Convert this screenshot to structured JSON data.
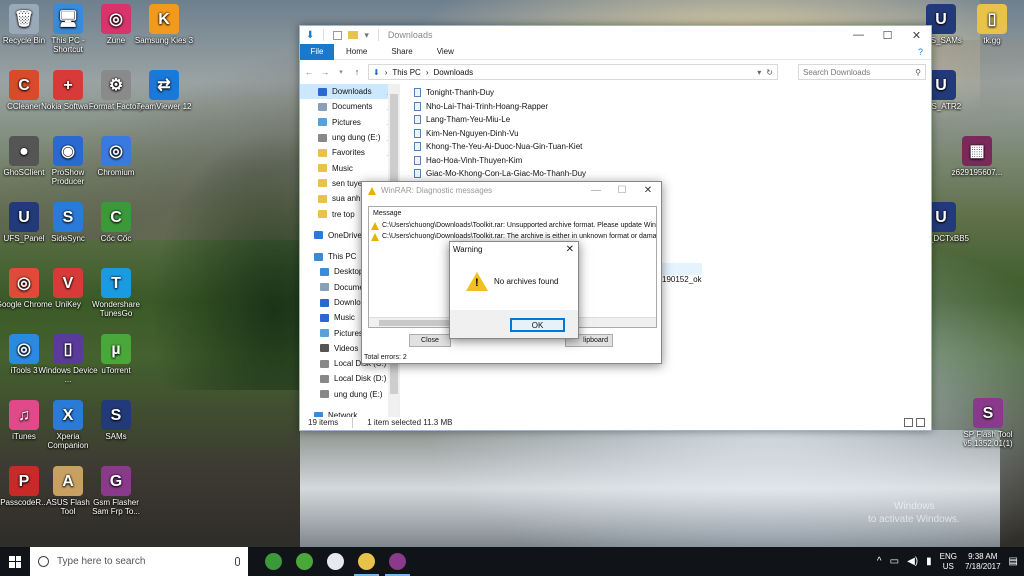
{
  "desktop_icons": [
    {
      "label": "Recycle Bin",
      "icon": "recycle-bin-icon",
      "color": "#9aa9b8",
      "glyph": "🗑"
    },
    {
      "label": "This PC - Shortcut",
      "icon": "computer-icon",
      "color": "#3a8ad8",
      "glyph": "🖥"
    },
    {
      "label": "Zune",
      "icon": "zune-icon",
      "color": "#d8336a",
      "glyph": "◎"
    },
    {
      "label": "Samsung Kies 3",
      "icon": "kies-icon",
      "color": "#f29a1d",
      "glyph": "K"
    },
    {
      "label": "CCleaner",
      "icon": "ccleaner-icon",
      "color": "#d84a2a",
      "glyph": "C"
    },
    {
      "label": "Nokia Softwa...",
      "icon": "nokia-icon",
      "color": "#d83a3a",
      "glyph": "+"
    },
    {
      "label": "Format Factory",
      "icon": "format-factory-icon",
      "color": "#8a8a8a",
      "glyph": "⚙"
    },
    {
      "label": "TeamViewer 12",
      "icon": "teamviewer-icon",
      "color": "#1a78d8",
      "glyph": "⇄"
    },
    {
      "label": "GhoSClient",
      "icon": "ghost-icon",
      "color": "#555555",
      "glyph": "●"
    },
    {
      "label": "ProShow Producer",
      "icon": "proshow-icon",
      "color": "#2a6ad0",
      "glyph": "◉"
    },
    {
      "label": "Chromium",
      "icon": "chromium-icon",
      "color": "#3a7ae0",
      "glyph": "◎"
    },
    {
      "label": "UFS_Panel",
      "icon": "ufs-panel-icon",
      "color": "#233a7a",
      "glyph": "U"
    },
    {
      "label": "SideSync",
      "icon": "sidesync-icon",
      "color": "#2a7ad8",
      "glyph": "S"
    },
    {
      "label": "Cốc Cốc",
      "icon": "coccoc-icon",
      "color": "#3a9a3a",
      "glyph": "C"
    },
    {
      "label": "Google Chrome",
      "icon": "chrome-icon",
      "color": "#e04a3a",
      "glyph": "◎"
    },
    {
      "label": "UniKey",
      "icon": "unikey-icon",
      "color": "#d83a3a",
      "glyph": "V"
    },
    {
      "label": "Wondershare TunesGo",
      "icon": "tunesgo-icon",
      "color": "#1a9ae0",
      "glyph": "T"
    },
    {
      "label": "iTools 3",
      "icon": "itools-icon",
      "color": "#2a8ae0",
      "glyph": "◎"
    },
    {
      "label": "Windows Device ...",
      "icon": "windows-device-icon",
      "color": "#5a3a9a",
      "glyph": "▯"
    },
    {
      "label": "uTorrent",
      "icon": "utorrent-icon",
      "color": "#4aa83a",
      "glyph": "µ"
    },
    {
      "label": "iTunes",
      "icon": "itunes-icon",
      "color": "#e04a8a",
      "glyph": "♫"
    },
    {
      "label": "Xperia Companion",
      "icon": "xperia-icon",
      "color": "#2a7ad8",
      "glyph": "X"
    },
    {
      "label": "SAMs",
      "icon": "sams-icon",
      "color": "#233a7a",
      "glyph": "S"
    },
    {
      "label": "PasscodeR...",
      "icon": "passcode-icon",
      "color": "#c82a2a",
      "glyph": "P"
    },
    {
      "label": "ASUS Flash Tool",
      "icon": "asus-flash-icon",
      "color": "#c8a060",
      "glyph": "A"
    },
    {
      "label": "Gsm Flasher Sam Frp To...",
      "icon": "gsm-flasher-icon",
      "color": "#8a3a8a",
      "glyph": "G"
    },
    {
      "label": "UFS_SAMs",
      "icon": "ufs-sams-icon",
      "color": "#233a7a",
      "glyph": "U"
    },
    {
      "label": "tk.gg",
      "icon": "file-icon",
      "color": "#e8c24a",
      "glyph": "▯"
    },
    {
      "label": "UFS_ATR2",
      "icon": "ufs-atr2-icon",
      "color": "#233a7a",
      "glyph": "U"
    },
    {
      "label": "z629195607...",
      "icon": "image-file-icon",
      "color": "#7a2a5a",
      "glyph": "▦"
    },
    {
      "label": "UFS_DCTxBB5",
      "icon": "ufs-dct-icon",
      "color": "#233a7a",
      "glyph": "U"
    },
    {
      "label": "SP Flash Tool v5.1352.01(1)",
      "icon": "sp-flash-icon",
      "color": "#8a3a8a",
      "glyph": "S"
    }
  ],
  "explorer": {
    "title": "Downloads",
    "ribbon_tabs": [
      "File",
      "Home",
      "Share",
      "View"
    ],
    "path": [
      "This PC",
      "Downloads"
    ],
    "search_placeholder": "Search Downloads",
    "nav_items": [
      {
        "label": "Downloads",
        "selected": true,
        "pin": true,
        "color": "#2a6ad0"
      },
      {
        "label": "Documents",
        "pin": true,
        "color": "#8aa0b8"
      },
      {
        "label": "Pictures",
        "pin": true,
        "color": "#5aa0d8"
      },
      {
        "label": "ung dung (E:)",
        "pin": true,
        "color": "#888888"
      },
      {
        "label": "Favorites",
        "pin": true,
        "color": "#e8c24a"
      },
      {
        "label": "Music",
        "color": "#e8c24a"
      },
      {
        "label": "sen tuyen",
        "color": "#e8c24a"
      },
      {
        "label": "sua anh",
        "color": "#e8c24a"
      },
      {
        "label": "tre top",
        "color": "#e8c24a"
      },
      {
        "label": "OneDrive",
        "color": "#2a7ad8",
        "group": true
      },
      {
        "label": "This PC",
        "color": "#3a8ad8",
        "group": true
      },
      {
        "label": "Desktop",
        "color": "#3a8ad8",
        "sub": true
      },
      {
        "label": "Documents",
        "color": "#8aa0b8",
        "sub": true
      },
      {
        "label": "Downloads",
        "color": "#2a6ad0",
        "sub": true
      },
      {
        "label": "Music",
        "color": "#2a6ad0",
        "sub": true
      },
      {
        "label": "Pictures",
        "color": "#5aa0d8",
        "sub": true
      },
      {
        "label": "Videos",
        "color": "#555555",
        "sub": true
      },
      {
        "label": "Local Disk (C:)",
        "color": "#888888",
        "sub": true
      },
      {
        "label": "Local Disk (D:)",
        "color": "#888888",
        "sub": true
      },
      {
        "label": "ung dung (E:)",
        "color": "#888888",
        "sub": true
      },
      {
        "label": "Network",
        "color": "#3a8ad8",
        "group": true
      }
    ],
    "files": [
      "Tonight-Thanh-Duy",
      "Nho-Lai-Thai-Trinh-Hoang-Rapper",
      "Lang-Tham-Yeu-Miu-Le",
      "Kim-Nen-Nguyen-Dinh-Vu",
      "Khong-The-Yeu-Ai-Duoc-Nua-Gin-Tuan-Kiet",
      "Hao-Hoa-Vinh-Thuyen-Kim",
      "Giac-Mo-Khong-Con-La-Giac-Mo-Thanh-Duy"
    ],
    "partial_file": "190152_ok",
    "status": {
      "items": "19 items",
      "selected": "1 item selected  11.3 MB"
    }
  },
  "winrar": {
    "title": "WinRAR: Diagnostic messages",
    "column": "Message",
    "messages": [
      "C:\\Users\\chuong\\Downloads\\Toolkit.rar: Unsupported archive format. Please update Win",
      "C:\\Users\\chuong\\Downloads\\Toolkit.rar: The archive is either in unknown format or dama"
    ],
    "close_label": "Close",
    "clipboard_label": "lipboard",
    "total": "Total errors: 2"
  },
  "warning": {
    "title": "Warning",
    "message": "No archives found",
    "ok_label": "OK"
  },
  "watermark": {
    "line1": "Windows",
    "line2": "to activate Windows."
  },
  "taskbar": {
    "search_placeholder": "Type here to search",
    "apps": [
      {
        "name": "coccoc-taskbar-icon",
        "color": "#3a9a3a"
      },
      {
        "name": "utorrent-taskbar-icon",
        "color": "#4aa83a"
      },
      {
        "name": "itunes-taskbar-icon",
        "color": "#e8e8f0"
      },
      {
        "name": "file-explorer-taskbar-icon",
        "color": "#e8c24a",
        "active": true
      },
      {
        "name": "winrar-taskbar-icon",
        "color": "#8a3a8a",
        "active": true
      }
    ],
    "lang": "ENG",
    "region": "US",
    "time": "9:38 AM",
    "date": "7/18/2017"
  }
}
